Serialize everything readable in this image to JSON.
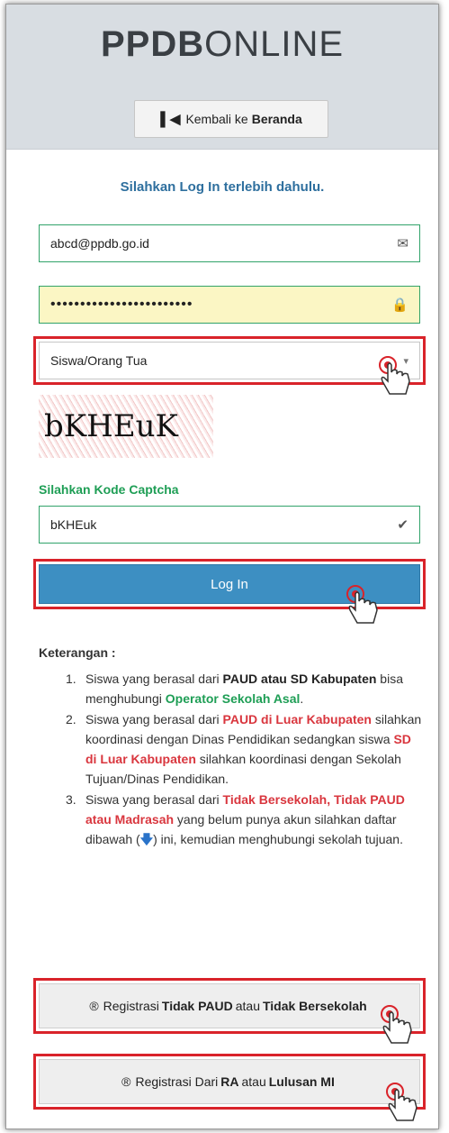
{
  "brand": {
    "bold": "PPDB",
    "light": "ONLINE"
  },
  "home_button": {
    "icon": "skip-back-icon",
    "prefix": "Kembali ke",
    "bold": "Beranda"
  },
  "login_prompt": "Silahkan Log In terlebih dahulu.",
  "email": {
    "value": "abcd@ppdb.go.id",
    "icon": "envelope-icon"
  },
  "password": {
    "masked": "••••••••••••••••••••••••",
    "icon": "lock-icon"
  },
  "role_select": {
    "value": "Siswa/Orang Tua",
    "caret": "▾"
  },
  "captcha": {
    "image_text": "bKHEuK"
  },
  "captcha_label": "Silahkan Kode Captcha",
  "captcha_input": {
    "value": "bKHEuk",
    "icon": "check-icon"
  },
  "login_button": "Log In",
  "notes": {
    "title": "Keterangan :",
    "item1": {
      "num": "1.",
      "t1": "Siswa yang berasal dari ",
      "b1": "PAUD atau SD Kabupaten",
      "t2": " bisa menghubungi ",
      "g1": "Operator Sekolah Asal",
      "t3": "."
    },
    "item2": {
      "num": "2.",
      "t1": "Siswa yang berasal dari ",
      "r1": "PAUD di Luar Kabupaten",
      "t2": " silahkan koordinasi dengan Dinas Pendidikan sedangkan siswa ",
      "r2": "SD di Luar Kabupaten",
      "t3": " silahkan koordinasi dengan Sekolah Tujuan/Dinas Pendidikan."
    },
    "item3": {
      "num": "3.",
      "t1": "Siswa yang berasal dari ",
      "r1": "Tidak Bersekolah, Tidak PAUD atau Madrasah",
      "t2": " yang belum punya akun silahkan daftar dibawah (",
      "arrow": "🡇",
      "t3": ") ini, kemudian menghubungi sekolah tujuan."
    }
  },
  "register1": {
    "icon": "registered-icon",
    "t1": "Registrasi",
    "b1": "Tidak PAUD",
    "t2": "atau",
    "b2": "Tidak Bersekolah"
  },
  "register2": {
    "icon": "registered-icon",
    "t1": "Registrasi Dari",
    "b1": "RA",
    "t2": "atau",
    "b2": "Lulusan MI"
  },
  "colors": {
    "highlight": "#d9232a",
    "login_button": "#3d8fc2",
    "field_border": "#31a36a",
    "prompt": "#2e6f9e"
  }
}
